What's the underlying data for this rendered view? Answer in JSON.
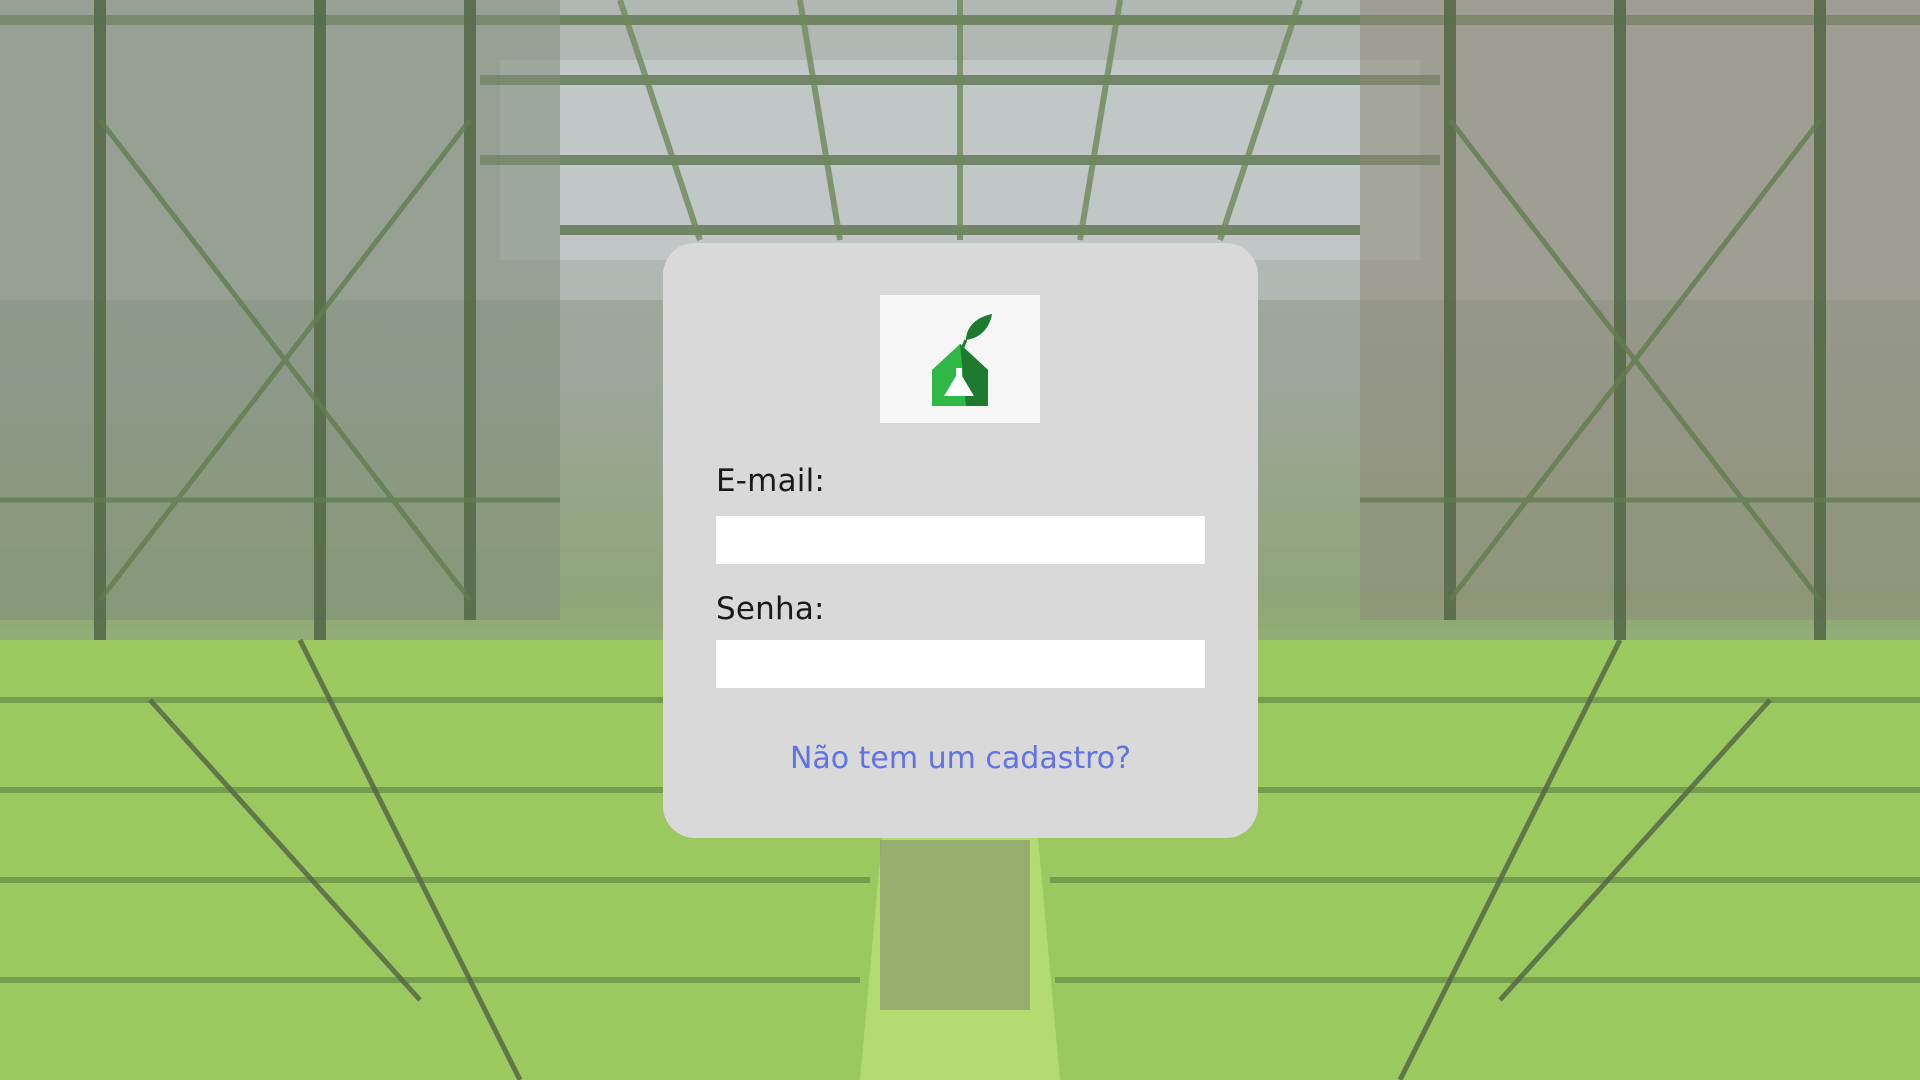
{
  "login": {
    "email_label": "E-mail:",
    "email_value": "",
    "password_label": "Senha:",
    "password_value": "",
    "register_link": "Não tem um cadastro?"
  },
  "logo": {
    "icon": "leaf-flask-logo-icon",
    "primary_color": "#1e7a2e",
    "accent_color": "#2fb845"
  },
  "colors": {
    "card_background": "#d9d9d9",
    "link": "#6172e6",
    "input_background": "#ffffff"
  }
}
